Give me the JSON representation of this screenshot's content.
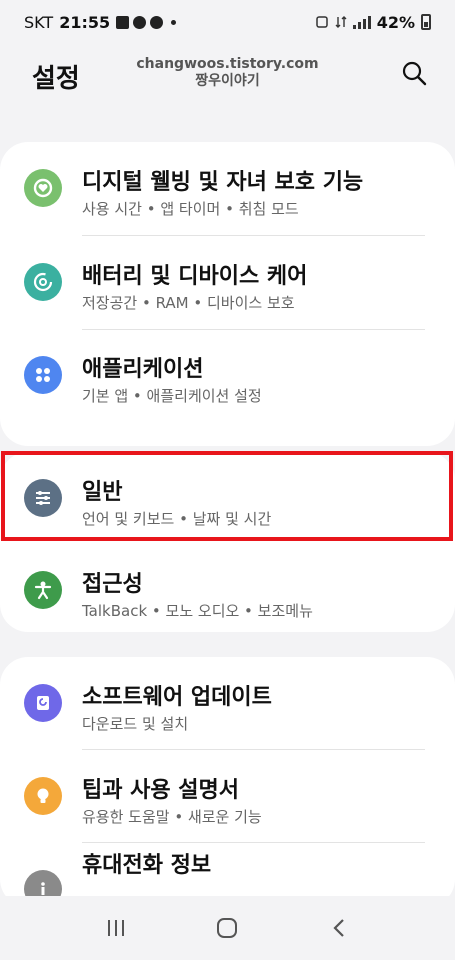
{
  "status": {
    "carrier": "SKT",
    "time": "21:55",
    "battery": "42%"
  },
  "header": {
    "title": "설정",
    "watermark_line1": "changwoos.tistory.com",
    "watermark_line2": "짱우이야기"
  },
  "items": [
    {
      "title": "디지털 웰빙 및 자녀 보호 기능",
      "sub": "사용 시간 • 앱 타이머 • 취침 모드",
      "color": "#7ac06e",
      "icon": "digital-wellbeing-icon"
    },
    {
      "title": "배터리 및 디바이스 케어",
      "sub": "저장공간 • RAM • 디바이스 보호",
      "color": "#3bb0a0",
      "icon": "device-care-icon"
    },
    {
      "title": "애플리케이션",
      "sub": "기본 앱 • 애플리케이션 설정",
      "color": "#4f86f0",
      "icon": "apps-grid-icon"
    },
    {
      "title": "일반",
      "sub": "언어 및 키보드 • 날짜 및 시간",
      "color": "#5c7085",
      "icon": "sliders-icon"
    },
    {
      "title": "접근성",
      "sub": "TalkBack • 모노 오디오 • 보조메뉴",
      "color": "#3e9b4b",
      "icon": "accessibility-person-icon"
    },
    {
      "title": "소프트웨어 업데이트",
      "sub": "다운로드 및 설치",
      "color": "#6f68e8",
      "icon": "software-update-icon"
    },
    {
      "title": "팁과 사용 설명서",
      "sub": "유용한 도움말 • 새로운 기능",
      "color": "#f4a83a",
      "icon": "lightbulb-icon"
    },
    {
      "title": "휴대전화 정보",
      "sub": "",
      "color": "#8a8a8a",
      "icon": "info-icon"
    }
  ]
}
